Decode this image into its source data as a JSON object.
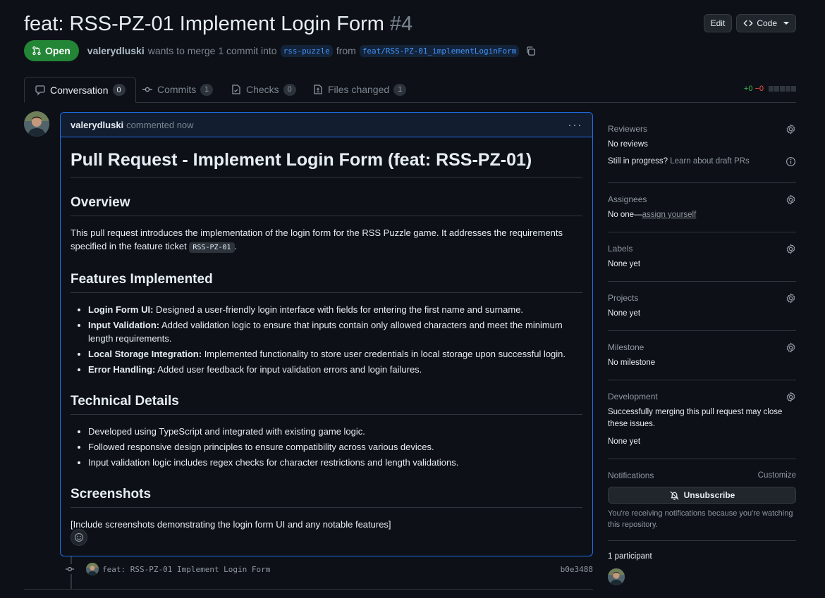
{
  "header": {
    "title": "feat: RSS-PZ-01 Implement Login Form",
    "number": "#4",
    "edit_label": "Edit",
    "code_label": "Code",
    "state": "Open",
    "author": "valerydluski",
    "merge_text": "wants to merge 1 commit into",
    "base_branch": "rss-puzzle",
    "from_text": "from",
    "head_branch": "feat/RSS-PZ-01_implementLoginForm"
  },
  "tabs": [
    {
      "label": "Conversation",
      "count": "0"
    },
    {
      "label": "Commits",
      "count": "1"
    },
    {
      "label": "Checks",
      "count": "0"
    },
    {
      "label": "Files changed",
      "count": "1"
    }
  ],
  "diffstat": {
    "additions": "+0",
    "deletions": "−0"
  },
  "comment": {
    "author": "valerydluski",
    "action": "commented now",
    "h1": "Pull Request - Implement Login Form (feat: RSS-PZ-01)",
    "overview_title": "Overview",
    "overview_text": "This pull request introduces the implementation of the login form for the RSS Puzzle game. It addresses the requirements specified in the feature ticket",
    "overview_code": "RSS-PZ-01",
    "overview_end": ".",
    "features_title": "Features Implemented",
    "features": [
      {
        "bold": "Login Form UI:",
        "text": " Designed a user-friendly login interface with fields for entering the first name and surname."
      },
      {
        "bold": "Input Validation:",
        "text": " Added validation logic to ensure that inputs contain only allowed characters and meet the minimum length requirements."
      },
      {
        "bold": "Local Storage Integration:",
        "text": " Implemented functionality to store user credentials in local storage upon successful login."
      },
      {
        "bold": "Error Handling:",
        "text": " Added user feedback for input validation errors and login failures."
      }
    ],
    "technical_title": "Technical Details",
    "technical": [
      "Developed using TypeScript and integrated with existing game logic.",
      "Followed responsive design principles to ensure compatibility across various devices.",
      "Input validation logic includes regex checks for character restrictions and length validations."
    ],
    "screenshots_title": "Screenshots",
    "screenshots_text": "[Include screenshots demonstrating the login form UI and any notable features]"
  },
  "commit": {
    "message": "feat: RSS-PZ-01 Implement Login Form",
    "sha": "b0e3488"
  },
  "sidebar": {
    "reviewers": {
      "title": "Reviewers",
      "value": "No reviews",
      "draft_label": "Still in progress?",
      "draft_link": "Learn about draft PRs"
    },
    "assignees": {
      "title": "Assignees",
      "value": "No one—",
      "link": "assign yourself"
    },
    "labels": {
      "title": "Labels",
      "value": "None yet"
    },
    "projects": {
      "title": "Projects",
      "value": "None yet"
    },
    "milestone": {
      "title": "Milestone",
      "value": "No milestone"
    },
    "development": {
      "title": "Development",
      "note": "Successfully merging this pull request may close these issues.",
      "value": "None yet"
    },
    "notifications": {
      "title": "Notifications",
      "customize": "Customize",
      "button": "Unsubscribe",
      "note": "You're receiving notifications because you're watching this repository."
    },
    "participants": {
      "title": "1 participant"
    }
  },
  "icons": [
    "pull-request-icon",
    "copy-icon",
    "code-icon",
    "chevron-down-icon",
    "comment-icon",
    "commit-icon",
    "checklist-icon",
    "file-diff-icon",
    "kebab-icon",
    "smiley-icon",
    "gear-icon",
    "info-icon",
    "bell-slash-icon"
  ]
}
